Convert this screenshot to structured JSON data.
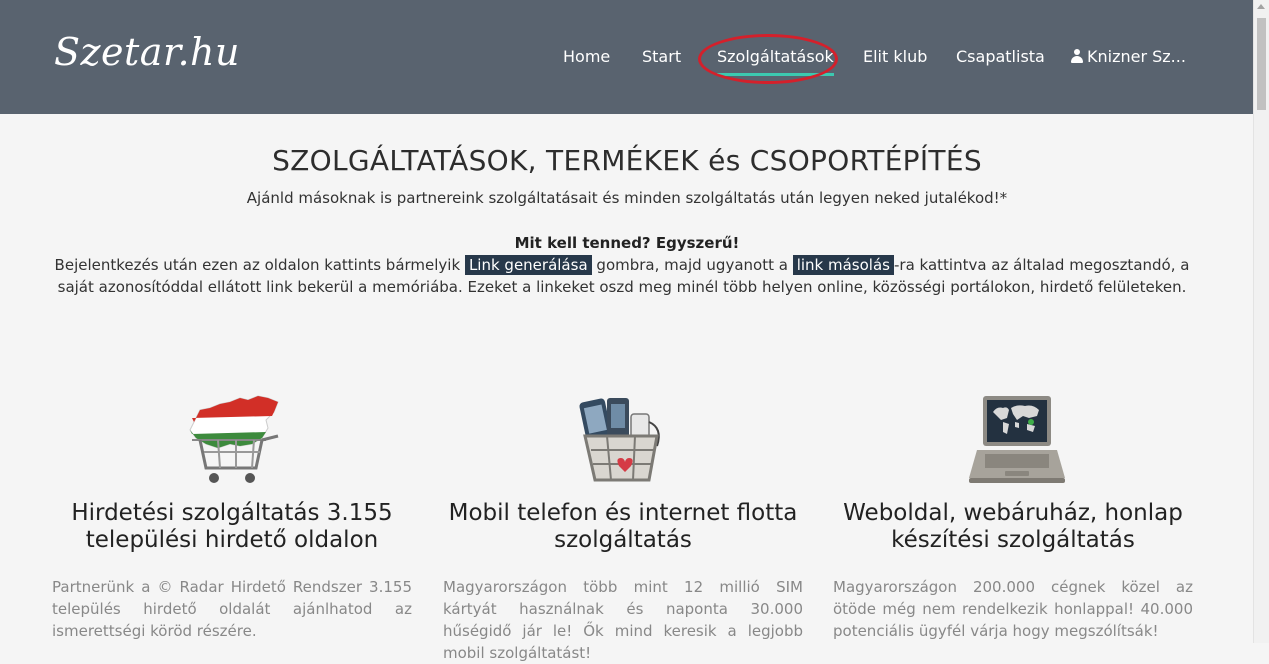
{
  "brand": "Szetar.hu",
  "nav": {
    "items": [
      "Home",
      "Start",
      "Szolgáltatások",
      "Elit klub",
      "Csapatlista"
    ],
    "user": "Knizner Sz..."
  },
  "hero": {
    "title": "SZOLGÁLTATÁSOK, TERMÉKEK és CSOPORTÉPÍTÉS",
    "subtitle": "Ajánld másoknak is partnereink szolgáltatásait és minden szolgáltatás után legyen neked jutalékod!*",
    "how_title": "Mit kell tenned? Egyszerű!",
    "desc_part1": "Bejelentkezés után ezen az oldalon kattints bármelyik",
    "link_generate": "Link generálása",
    "desc_part2": "gombra, majd ugyanott a",
    "link_copy": "link másolás",
    "desc_part3": "-ra kattintva az általad megosztandó, a saját azonosítóddal ellátott link bekerül a memóriába. Ezeket a linkeket oszd meg minél több helyen online, közösségi portálokon, hirdető felületeken."
  },
  "cards": [
    {
      "title": "Hirdetési szolgáltatás 3.155 települési hirdető oldalon",
      "text": "Partnerünk a © Radar Hirdető Rendszer 3.155 település hirdető oldalát ajánlhatod az ismerettségi köröd részére."
    },
    {
      "title": "Mobil telefon és internet flotta szolgáltatás",
      "text": "Magyarországon több mint 12 millió SIM kártyát használnak és naponta 30.000 hűségidő jár le! Ők mind keresik a legjobb mobil szolgáltatást!"
    },
    {
      "title": "Weboldal, webáruház, honlap készítési szolgáltatás",
      "text": "Magyarországon 200.000 cégnek közel az ötöde még nem rendelkezik honlappal! 40.000 potenciális ügyfél várja hogy megszólítsák!"
    }
  ],
  "colors": {
    "navbar": "#59636f",
    "active_underline": "#3cc9b0",
    "highlight_ring": "#d4202b",
    "tag_bg": "#27384a"
  }
}
